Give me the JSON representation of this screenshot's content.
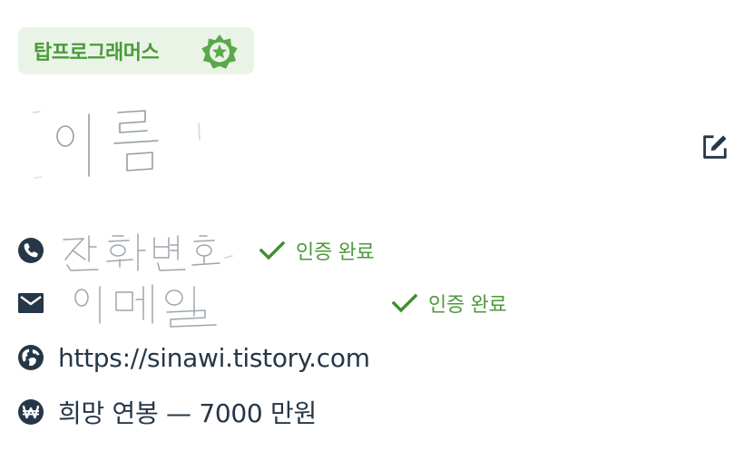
{
  "badge": {
    "label": "탑프로그래머스",
    "icon": "star-badge-icon",
    "bg_color": "#e9f4e6",
    "text_color": "#4c9a3a"
  },
  "profile": {
    "name_handwritten": "이름",
    "edit_icon": "edit-icon"
  },
  "contacts": {
    "phone": {
      "icon": "phone-icon",
      "value_handwritten": "전화번호",
      "verified_label": "인증 완료"
    },
    "email": {
      "icon": "mail-icon",
      "value_handwritten": "이메일",
      "verified_label": "인증 완료"
    },
    "website": {
      "icon": "globe-icon",
      "value": "https://sinawi.tistory.com"
    },
    "salary": {
      "icon": "won-icon",
      "value": "희망 연봉 — 7000 만원"
    }
  },
  "colors": {
    "text": "#263747",
    "accent_green": "#4c9a3a",
    "check_green": "#3f8f2c"
  }
}
